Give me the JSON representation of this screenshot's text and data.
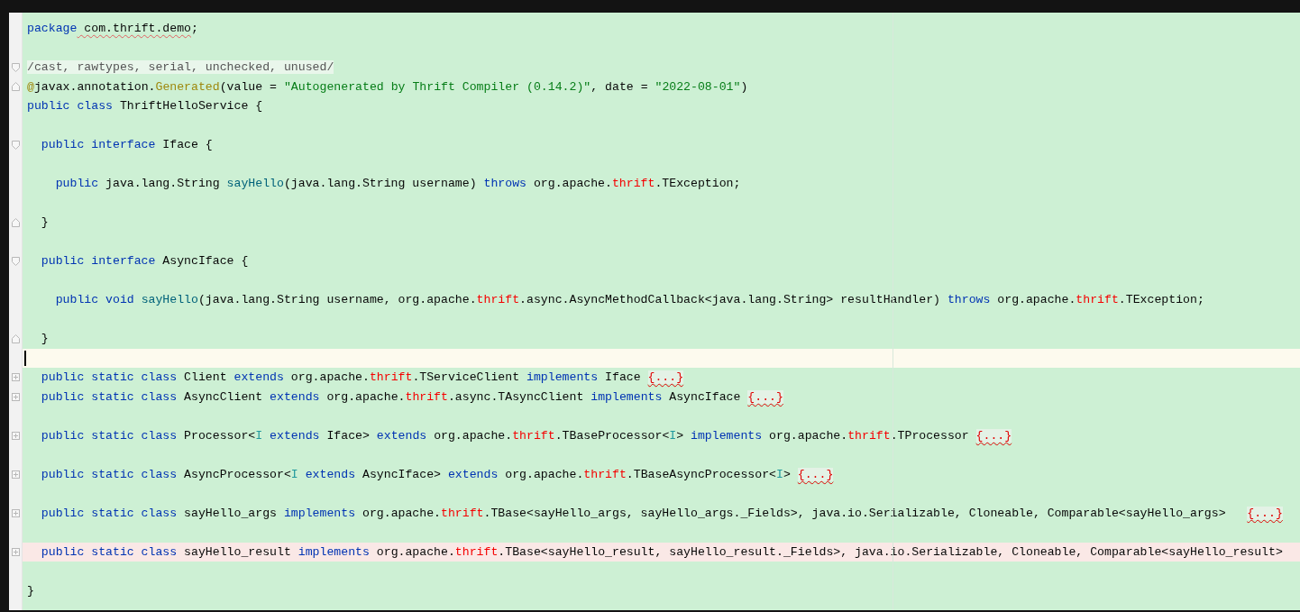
{
  "editor": {
    "lines": [
      {
        "kind": "code",
        "tokens": [
          {
            "kind": "keyword",
            "text": "package"
          },
          {
            "kind": "typo",
            "text": " com.thrift.demo"
          },
          {
            "kind": "plain",
            "text": ";"
          }
        ]
      },
      {
        "kind": "blank"
      },
      {
        "kind": "code",
        "fold_start": true,
        "tokens": [
          {
            "kind": "suppressed",
            "text": "/cast, rawtypes, serial, unchecked, unused/"
          }
        ]
      },
      {
        "kind": "code",
        "fold_end": true,
        "tokens": [
          {
            "kind": "annotation",
            "text": "@"
          },
          {
            "kind": "plain",
            "text": "javax.annotation."
          },
          {
            "kind": "annotation",
            "text": "Generated"
          },
          {
            "kind": "plain",
            "text": "(value = "
          },
          {
            "kind": "string",
            "text": "\"Autogenerated by Thrift Compiler (0.14.2)\""
          },
          {
            "kind": "plain",
            "text": ", date = "
          },
          {
            "kind": "string",
            "text": "\"2022-08-01\""
          },
          {
            "kind": "plain",
            "text": ")"
          }
        ]
      },
      {
        "kind": "code",
        "tokens": [
          {
            "kind": "keyword",
            "text": "public class"
          },
          {
            "kind": "plain",
            "text": " ThriftHelloService {"
          }
        ]
      },
      {
        "kind": "blank"
      },
      {
        "kind": "code",
        "fold_start": true,
        "tokens": [
          {
            "kind": "keyword",
            "text": "  public interface"
          },
          {
            "kind": "plain",
            "text": " Iface {"
          }
        ]
      },
      {
        "kind": "blank"
      },
      {
        "kind": "code",
        "tokens": [
          {
            "kind": "keyword",
            "text": "    public"
          },
          {
            "kind": "plain",
            "text": " java.lang.String "
          },
          {
            "kind": "method",
            "text": "sayHello"
          },
          {
            "kind": "plain",
            "text": "(java.lang.String username) "
          },
          {
            "kind": "keyword",
            "text": "throws"
          },
          {
            "kind": "plain",
            "text": " org.apache."
          },
          {
            "kind": "error",
            "text": "thrift"
          },
          {
            "kind": "plain",
            "text": ".TException;"
          }
        ]
      },
      {
        "kind": "blank"
      },
      {
        "kind": "code",
        "fold_end": true,
        "tokens": [
          {
            "kind": "plain",
            "text": "  }"
          }
        ]
      },
      {
        "kind": "blank"
      },
      {
        "kind": "code",
        "fold_start": true,
        "tokens": [
          {
            "kind": "keyword",
            "text": "  public interface"
          },
          {
            "kind": "plain",
            "text": " AsyncIface {"
          }
        ]
      },
      {
        "kind": "blank"
      },
      {
        "kind": "code",
        "tokens": [
          {
            "kind": "keyword",
            "text": "    public void"
          },
          {
            "kind": "method",
            "text": " sayHello"
          },
          {
            "kind": "plain",
            "text": "(java.lang.String username, org.apache."
          },
          {
            "kind": "error",
            "text": "thrift"
          },
          {
            "kind": "plain",
            "text": ".async.AsyncMethodCallback<java.lang.String> resultHandler) "
          },
          {
            "kind": "keyword",
            "text": "throws"
          },
          {
            "kind": "plain",
            "text": " org.apache."
          },
          {
            "kind": "error",
            "text": "thrift"
          },
          {
            "kind": "plain",
            "text": ".TException;"
          }
        ]
      },
      {
        "kind": "blank"
      },
      {
        "kind": "code",
        "fold_end": true,
        "tokens": [
          {
            "kind": "plain",
            "text": "  }"
          }
        ]
      },
      {
        "kind": "blank",
        "current_line": true,
        "cursor": true
      },
      {
        "kind": "code",
        "collapsed": true,
        "tokens": [
          {
            "kind": "keyword",
            "text": "  public static class"
          },
          {
            "kind": "plain",
            "text": " Client "
          },
          {
            "kind": "keyword",
            "text": "extends"
          },
          {
            "kind": "plain",
            "text": " org.apache."
          },
          {
            "kind": "error",
            "text": "thrift"
          },
          {
            "kind": "plain",
            "text": ".TServiceClient "
          },
          {
            "kind": "keyword",
            "text": "implements"
          },
          {
            "kind": "plain",
            "text": " Iface "
          },
          {
            "kind": "folded",
            "text": "{...}"
          }
        ]
      },
      {
        "kind": "code",
        "collapsed": true,
        "tokens": [
          {
            "kind": "keyword",
            "text": "  public static class"
          },
          {
            "kind": "plain",
            "text": " AsyncClient "
          },
          {
            "kind": "keyword",
            "text": "extends"
          },
          {
            "kind": "plain",
            "text": " org.apache."
          },
          {
            "kind": "error",
            "text": "thrift"
          },
          {
            "kind": "plain",
            "text": ".async.TAsyncClient "
          },
          {
            "kind": "keyword",
            "text": "implements"
          },
          {
            "kind": "plain",
            "text": " AsyncIface "
          },
          {
            "kind": "folded",
            "text": "{...}"
          }
        ]
      },
      {
        "kind": "blank"
      },
      {
        "kind": "code",
        "collapsed": true,
        "tokens": [
          {
            "kind": "keyword",
            "text": "  public static class"
          },
          {
            "kind": "plain",
            "text": " Processor<"
          },
          {
            "kind": "type-param",
            "text": "I"
          },
          {
            "kind": "keyword",
            "text": " extends"
          },
          {
            "kind": "plain",
            "text": " Iface> "
          },
          {
            "kind": "keyword",
            "text": "extends"
          },
          {
            "kind": "plain",
            "text": " org.apache."
          },
          {
            "kind": "error",
            "text": "thrift"
          },
          {
            "kind": "plain",
            "text": ".TBaseProcessor<"
          },
          {
            "kind": "type-param",
            "text": "I"
          },
          {
            "kind": "plain",
            "text": "> "
          },
          {
            "kind": "keyword",
            "text": "implements"
          },
          {
            "kind": "plain",
            "text": " org.apache."
          },
          {
            "kind": "error",
            "text": "thrift"
          },
          {
            "kind": "plain",
            "text": ".TProcessor "
          },
          {
            "kind": "folded",
            "text": "{...}"
          }
        ]
      },
      {
        "kind": "blank"
      },
      {
        "kind": "code",
        "collapsed": true,
        "tokens": [
          {
            "kind": "keyword",
            "text": "  public static class"
          },
          {
            "kind": "plain",
            "text": " AsyncProcessor<"
          },
          {
            "kind": "type-param",
            "text": "I"
          },
          {
            "kind": "keyword",
            "text": " extends"
          },
          {
            "kind": "plain",
            "text": " AsyncIface> "
          },
          {
            "kind": "keyword",
            "text": "extends"
          },
          {
            "kind": "plain",
            "text": " org.apache."
          },
          {
            "kind": "error",
            "text": "thrift"
          },
          {
            "kind": "plain",
            "text": ".TBaseAsyncProcessor<"
          },
          {
            "kind": "type-param",
            "text": "I"
          },
          {
            "kind": "plain",
            "text": "> "
          },
          {
            "kind": "folded",
            "text": "{...}"
          }
        ]
      },
      {
        "kind": "blank"
      },
      {
        "kind": "code",
        "collapsed": true,
        "tokens": [
          {
            "kind": "keyword",
            "text": "  public static class"
          },
          {
            "kind": "plain",
            "text": " sayHello_args "
          },
          {
            "kind": "keyword",
            "text": "implements"
          },
          {
            "kind": "plain",
            "text": " org.apache."
          },
          {
            "kind": "error",
            "text": "thrift"
          },
          {
            "kind": "plain",
            "text": ".TBase<sayHello_args, sayHello_args._Fields>, java.io.Serializable, Cloneable, Comparable<sayHello_args>   "
          },
          {
            "kind": "folded",
            "text": "{...}"
          }
        ]
      },
      {
        "kind": "blank"
      },
      {
        "kind": "code",
        "collapsed": true,
        "error_line": true,
        "tokens": [
          {
            "kind": "keyword",
            "text": "  public static class"
          },
          {
            "kind": "plain",
            "text": " sayHello_result "
          },
          {
            "kind": "keyword",
            "text": "implements"
          },
          {
            "kind": "plain",
            "text": " org.apache."
          },
          {
            "kind": "error",
            "text": "thrift"
          },
          {
            "kind": "plain",
            "text": ".TBase<sayHello_result, sayHello_result._Fields>, java.io.Serializable, Cloneable, Comparable<sayHello_result>"
          }
        ]
      },
      {
        "kind": "blank"
      },
      {
        "kind": "code",
        "tokens": [
          {
            "kind": "plain",
            "text": "}"
          }
        ]
      }
    ]
  }
}
